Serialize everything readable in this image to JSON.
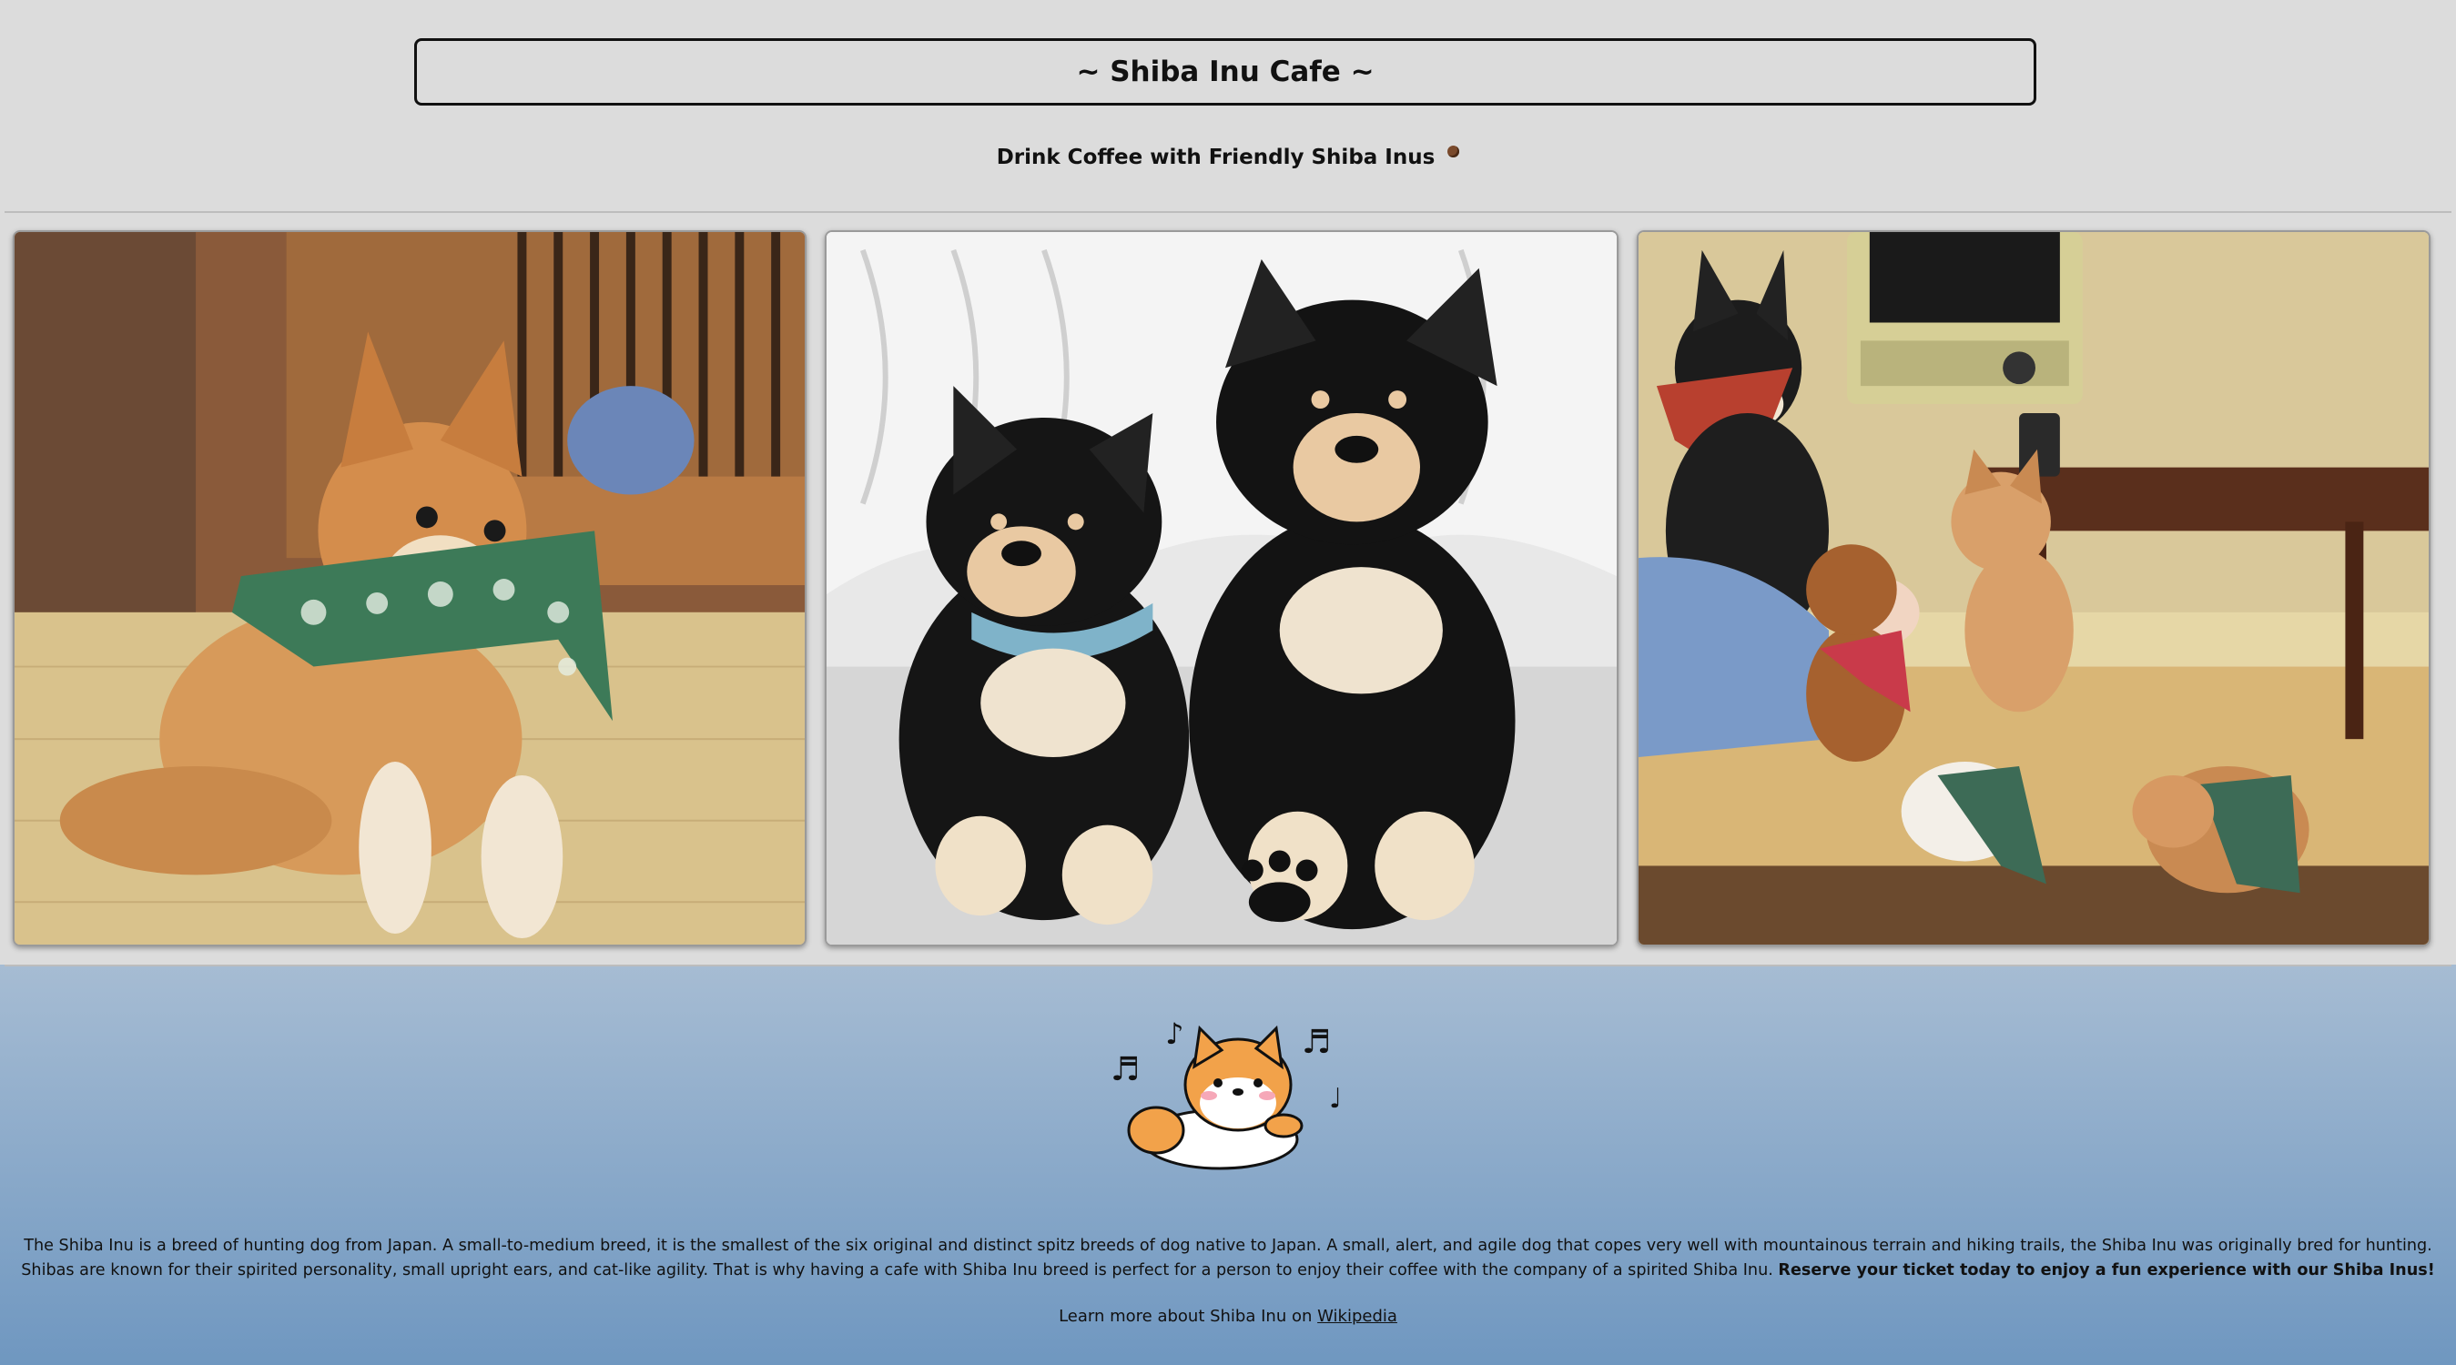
{
  "header": {
    "title": "~ Shiba Inu Cafe ~",
    "subtitle": "Drink Coffee with Friendly Shiba Inus",
    "coffee_bean_icon": "coffee-bean-icon"
  },
  "gallery": {
    "photos": [
      {
        "name": "shiba-puppy-green-bandana-photo"
      },
      {
        "name": "two-black-tan-shiba-puppies-photo"
      },
      {
        "name": "shiba-cafe-group-photo"
      }
    ]
  },
  "mascot": {
    "name": "singing-shiba-mascot-icon"
  },
  "description": {
    "text": "The Shiba Inu is a breed of hunting dog from Japan. A small-to-medium breed, it is the smallest of the six original and distinct spitz breeds of dog native to Japan. A small, alert, and agile dog that copes very well with mountainous terrain and hiking trails, the Shiba Inu was originally bred for hunting. Shibas are known for their spirited personality, small upright ears, and cat-like agility. That is why having a cafe with Shiba Inu breed is perfect for a person to enjoy their coffee with the company of a spirited Shiba Inu.",
    "cta": "Reserve your ticket today to enjoy a fun experience with our Shiba Inus!"
  },
  "footer": {
    "learn_prefix": "Learn more about Shiba Inu on",
    "link_text": "Wikipedia"
  },
  "colors": {
    "background_top": "#dcdcdc",
    "footer_gradient_start": "#a6bcd3",
    "footer_gradient_end": "#6f97c0"
  }
}
